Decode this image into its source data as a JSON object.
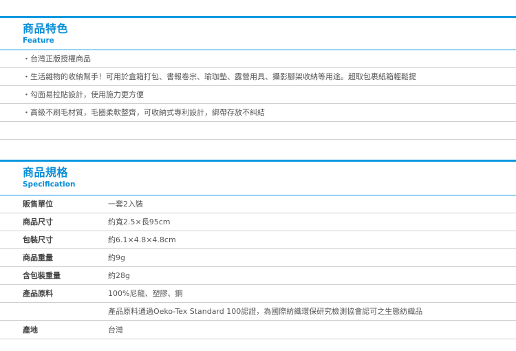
{
  "feature": {
    "title": "商品特色",
    "subtitle": "Feature",
    "items": [
      "・台灣正版授權商品",
      "・生活雜物的收納幫手！可用於盒箱打包、書報卷宗、瑜珈墊、露營用具、攝影腳架收納等用途。超取包裹紙箱輕鬆提",
      "・勾面易拉貼設計，使用施力更方便",
      "・高級不刷毛材質，毛圈柔軟整齊，可收納式專利設計，綁帶存放不糾結",
      ""
    ]
  },
  "specification": {
    "title": "商品規格",
    "subtitle": "Specification",
    "rows": [
      {
        "label": "販售單位",
        "value": "一套2入裝"
      },
      {
        "label": "商品尺寸",
        "value": "約寬2.5×長95cm"
      },
      {
        "label": "包裝尺寸",
        "value": "約6.1×4.8×4.8cm"
      },
      {
        "label": "商品重量",
        "value": "約9g"
      },
      {
        "label": "含包裝重量",
        "value": "約28g"
      },
      {
        "label": "產品原料",
        "value": "100%尼龍、塑膠、鋼"
      },
      {
        "label": "",
        "value": "產品原料通過Oeko-Tex Standard 100認證，為國際紡織環保研究檢測協會認可之生態紡織品"
      },
      {
        "label": "產地",
        "value": "台灣"
      }
    ]
  },
  "colors": {
    "accent": "#0a98df",
    "divider": "#cfcfcf",
    "text": "#555555"
  }
}
